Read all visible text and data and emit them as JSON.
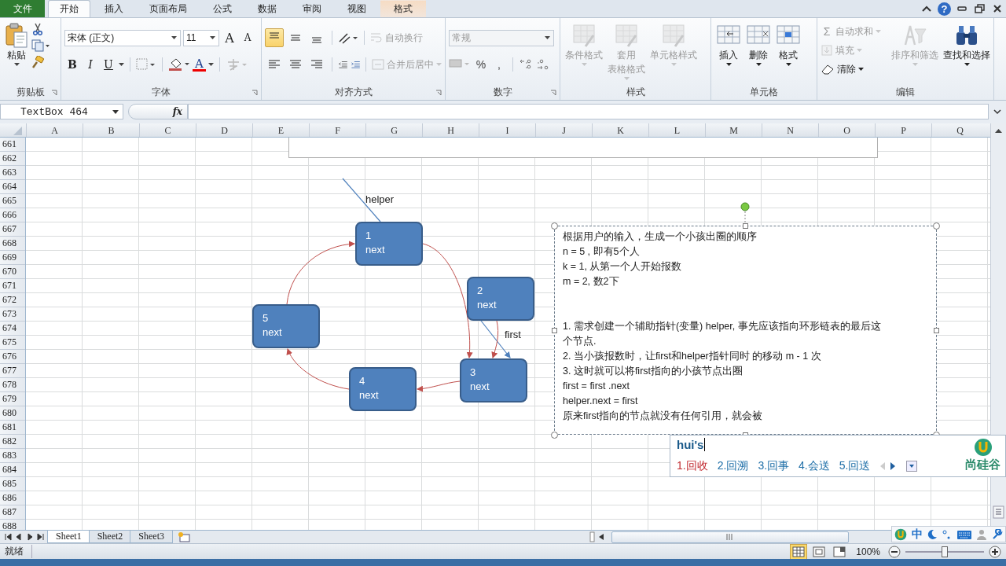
{
  "tabs": [
    {
      "label": "文件",
      "kind": "file",
      "selected": false
    },
    {
      "label": "开始",
      "kind": "normal",
      "selected": true
    },
    {
      "label": "插入",
      "kind": "normal",
      "selected": false
    },
    {
      "label": "页面布局",
      "kind": "normal",
      "selected": false
    },
    {
      "label": "公式",
      "kind": "normal",
      "selected": false
    },
    {
      "label": "数据",
      "kind": "normal",
      "selected": false
    },
    {
      "label": "审阅",
      "kind": "normal",
      "selected": false
    },
    {
      "label": "视图",
      "kind": "normal",
      "selected": false
    },
    {
      "label": "格式",
      "kind": "context",
      "selected": false
    }
  ],
  "help": "?",
  "ribbon": {
    "clipboard": {
      "title": "剪贴板",
      "paste": "粘贴"
    },
    "font": {
      "title": "字体",
      "font_name": "宋体 (正文)",
      "font_size": "11",
      "grow": "A",
      "shrink": "A",
      "bold": "B",
      "italic": "I",
      "underline": "U",
      "font_color": "A"
    },
    "alignment": {
      "title": "对齐方式",
      "vertical": [
        {
          "selected": true
        },
        {
          "selected": false
        },
        {
          "selected": false
        }
      ],
      "horizontal": [
        {
          "selected": false
        },
        {
          "selected": false
        },
        {
          "selected": false
        }
      ],
      "wrap": {
        "label": "自动换行",
        "disabled": true
      },
      "merge": {
        "label": "合并后居中",
        "disabled": true
      }
    },
    "number": {
      "title": "数字",
      "format": {
        "value": "常规",
        "disabled": true
      },
      "percent": "%",
      "comma": ","
    },
    "styles": {
      "title": "样式",
      "buttons": [
        {
          "label": "条件格式",
          "disabled": true
        },
        {
          "label": "套用",
          "label_2": "表格格式",
          "disabled": true
        },
        {
          "label": "单元格样式",
          "disabled": true
        }
      ]
    },
    "cells": {
      "title": "单元格",
      "buttons": [
        {
          "label": "插入",
          "disabled": false
        },
        {
          "label": "删除",
          "disabled": false
        },
        {
          "label": "格式",
          "disabled": false
        }
      ]
    },
    "editing": {
      "title": "编辑",
      "sum_symbol": "Σ",
      "small": [
        {
          "label": "自动求和",
          "disabled": true
        },
        {
          "label": "填充",
          "disabled": true
        },
        {
          "label": "清除",
          "disabled": false
        }
      ],
      "buttons": [
        {
          "label": "排序和筛选",
          "disabled": true
        },
        {
          "label": "查找和选择",
          "disabled": false
        }
      ]
    }
  },
  "formula_bar": {
    "name_box": "TextBox 464",
    "function_label": "fx"
  },
  "columns": [
    "A",
    "B",
    "C",
    "D",
    "E",
    "F",
    "G",
    "H",
    "I",
    "J",
    "K",
    "L",
    "M",
    "N",
    "O",
    "P",
    "Q"
  ],
  "rows": [
    "661",
    "662",
    "663",
    "664",
    "665",
    "666",
    "667",
    "668",
    "669",
    "670",
    "671",
    "672",
    "673",
    "674",
    "675",
    "676",
    "677",
    "678",
    "679",
    "680",
    "681",
    "682",
    "683",
    "684",
    "685",
    "686",
    "687",
    "688"
  ],
  "diagram": {
    "nodes": [
      {
        "number": "1",
        "label": "next"
      },
      {
        "number": "2",
        "label": "next"
      },
      {
        "number": "3",
        "label": "next"
      },
      {
        "number": "4",
        "label": "next"
      },
      {
        "number": "5",
        "label": "next"
      }
    ],
    "helper_label": "helper",
    "first_label": "first"
  },
  "text_box": {
    "intro": [
      "根据用户的输入，生成一个小孩出圈的顺序",
      "n = 5 , 即有5个人",
      "k = 1, 从第一个人开始报数",
      "m = 2, 数2下"
    ],
    "steps": [
      "1.  需求创建一个辅助指针(变量) helper, 事先应该指向环形链表的最后这",
      "个节点.",
      "2.  当小孩报数时，让first和helper指针同时 的移动  m  - 1 次",
      "3.  这时就可以将first指向的小孩节点出圈",
      "first = first .next",
      "helper.next = first",
      "原来first指向的节点就没有任何引用，就会被"
    ]
  },
  "ime": {
    "input": "hui's",
    "candidates": [
      {
        "text": "1.回收",
        "selected": true
      },
      {
        "text": "2.回溯",
        "selected": false
      },
      {
        "text": "3.回事",
        "selected": false
      },
      {
        "text": "4.会送",
        "selected": false
      },
      {
        "text": "5.回送",
        "selected": false
      }
    ],
    "logo": "尚硅谷",
    "mode": "中"
  },
  "sheets": [
    {
      "label": "Sheet1",
      "selected": true
    },
    {
      "label": "Sheet2",
      "selected": false
    },
    {
      "label": "Sheet3",
      "selected": false
    }
  ],
  "status": {
    "ready": "就绪",
    "zoom": "100%",
    "zoom_slider": {
      "level": 0.5
    }
  }
}
